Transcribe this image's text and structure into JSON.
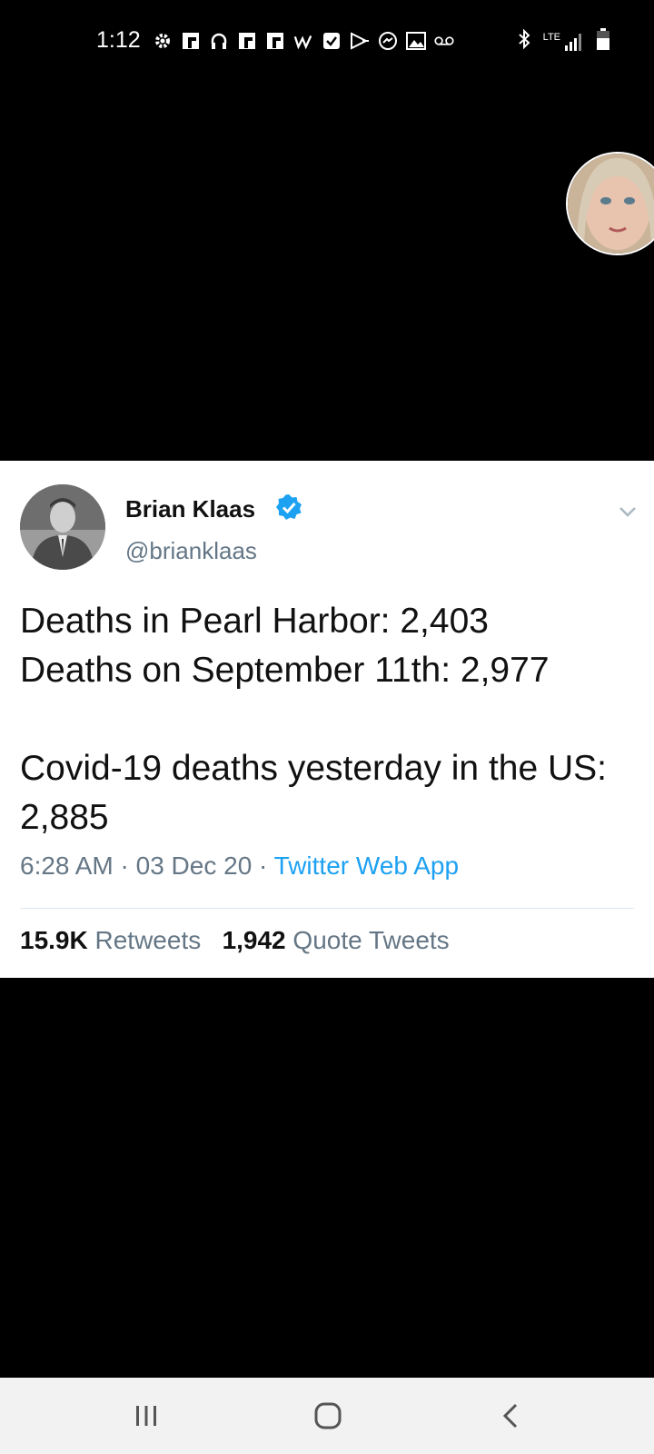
{
  "status_bar": {
    "time": "1:12",
    "icons": [
      "gear-icon",
      "flipboard-icon",
      "headphones-icon",
      "flipboard-icon",
      "flipboard-icon",
      "w-app-icon",
      "check-box-icon",
      "play-store-icon",
      "messenger-icon",
      "gallery-icon",
      "voicemail-icon"
    ],
    "system": [
      "bluetooth-icon",
      "lte-signal-icon",
      "battery-icon"
    ],
    "network": "LTE"
  },
  "tweet": {
    "author_name": "Brian Klaas",
    "handle": "@brianklaas",
    "text": "Deaths in Pearl Harbor: 2,403\nDeaths on September 11th: 2,977\n\nCovid-19 deaths yesterday in the US: 2,885",
    "time": "6:28 AM",
    "date": "03 Dec 20",
    "separator": " · ",
    "source": "Twitter Web App",
    "retweets_count": "15.9K",
    "retweets_label": "Retweets",
    "quotes_count": "1,942",
    "quotes_label": "Quote Tweets"
  },
  "nav": [
    "recent-apps-icon",
    "home-icon",
    "back-icon"
  ],
  "colors": {
    "accent": "#1da1f2",
    "muted": "#657786",
    "verified": "#1da1f2"
  }
}
